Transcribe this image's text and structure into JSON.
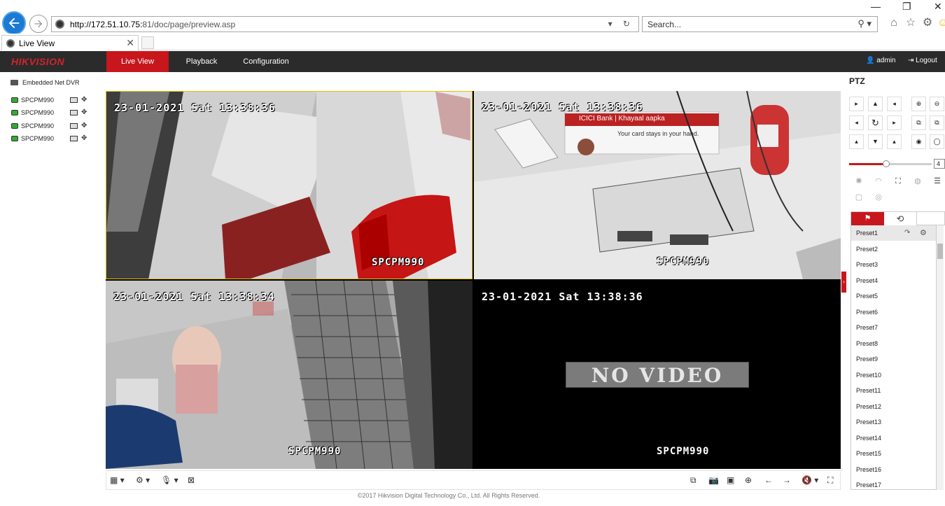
{
  "browser": {
    "url_host": "http://172.51.10.75:",
    "url_rest": "81/doc/page/preview.asp",
    "search_placeholder": "Search...",
    "tab_title": "Live View"
  },
  "app": {
    "logo": "HIKVISION",
    "nav": {
      "live_view": "Live View",
      "playback": "Playback",
      "configuration": "Configuration"
    },
    "user": "admin",
    "logout": "Logout"
  },
  "left_panel": {
    "device": "Embedded Net DVR",
    "cameras": [
      "SPCPM990",
      "SPCPM990",
      "SPCPM990",
      "SPCPM990"
    ]
  },
  "video": {
    "tiles": [
      {
        "timestamp": "23-01-2021 Sat 13:38:36",
        "name": "SPCPM990"
      },
      {
        "timestamp": "23-01-2021 Sat 13:38:36",
        "name": "SPCPM990"
      },
      {
        "timestamp": "23-01-2021 Sat 13:38:34",
        "name": "SPCPM990"
      },
      {
        "timestamp": "23-01-2021 Sat 13:38:36",
        "name": "SPCPM990",
        "overlay": "NO VIDEO"
      }
    ],
    "bank_sign": "ICICI Bank | Khayaal aapka",
    "bank_tagline": "Your card stays in your hand."
  },
  "ptz": {
    "title": "PTZ",
    "speed": "4",
    "speed_fraction": 0.45,
    "presets": [
      "Preset1",
      "Preset2",
      "Preset3",
      "Preset4",
      "Preset5",
      "Preset6",
      "Preset7",
      "Preset8",
      "Preset9",
      "Preset10",
      "Preset11",
      "Preset12",
      "Preset13",
      "Preset14",
      "Preset15",
      "Preset16",
      "Preset17"
    ]
  },
  "footer": "©2017 Hikvision Digital Technology Co., Ltd. All Rights Reserved.",
  "colors": {
    "accent": "#c8161d",
    "header": "#2b2b2b",
    "selected_tile": "#e6c000"
  }
}
